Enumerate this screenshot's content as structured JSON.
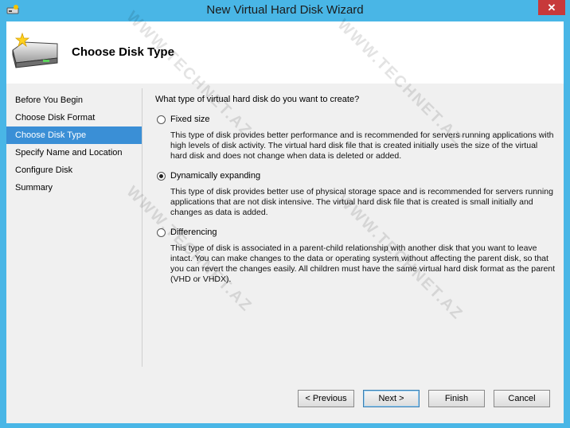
{
  "window": {
    "title": "New Virtual Hard Disk Wizard",
    "close_label": "✕"
  },
  "header": {
    "title": "Choose Disk Type"
  },
  "steps": [
    {
      "label": "Before You Begin",
      "active": false
    },
    {
      "label": "Choose Disk Format",
      "active": false
    },
    {
      "label": "Choose Disk Type",
      "active": true
    },
    {
      "label": "Specify Name and Location",
      "active": false
    },
    {
      "label": "Configure Disk",
      "active": false
    },
    {
      "label": "Summary",
      "active": false
    }
  ],
  "content": {
    "question": "What type of virtual hard disk do you want to create?",
    "options": [
      {
        "label": "Fixed size",
        "checked": false,
        "description": "This type of disk provides better performance and is recommended for servers running applications with high levels of disk activity. The virtual hard disk file that is created initially uses the size of the virtual hard disk and does not change when data is deleted or added."
      },
      {
        "label": "Dynamically expanding",
        "checked": true,
        "description": "This type of disk provides better use of physical storage space and is recommended for servers running applications that are not disk intensive. The virtual hard disk file that is created is small initially and changes as data is added."
      },
      {
        "label": "Differencing",
        "checked": false,
        "description": "This type of disk is associated in a parent-child relationship with another disk that you want to leave intact. You can make changes to the data or operating system without affecting the parent disk, so that you can revert the changes easily. All children must have the same virtual hard disk format as the parent (VHD or VHDX)."
      }
    ]
  },
  "buttons": {
    "previous": "< Previous",
    "next": "Next >",
    "finish": "Finish",
    "cancel": "Cancel"
  },
  "watermark": "WWW.TECHNET.AZ",
  "colors": {
    "titlebar": "#49b6e6",
    "close_button": "#c7393a",
    "active_step": "#3a8fd6",
    "panel": "#f0f0f0"
  },
  "icons": {
    "title": "disk-wizard-icon",
    "header": "new-hard-disk-icon",
    "radio_unchecked": "radio-icon",
    "radio_checked": "radio-checked-icon"
  }
}
